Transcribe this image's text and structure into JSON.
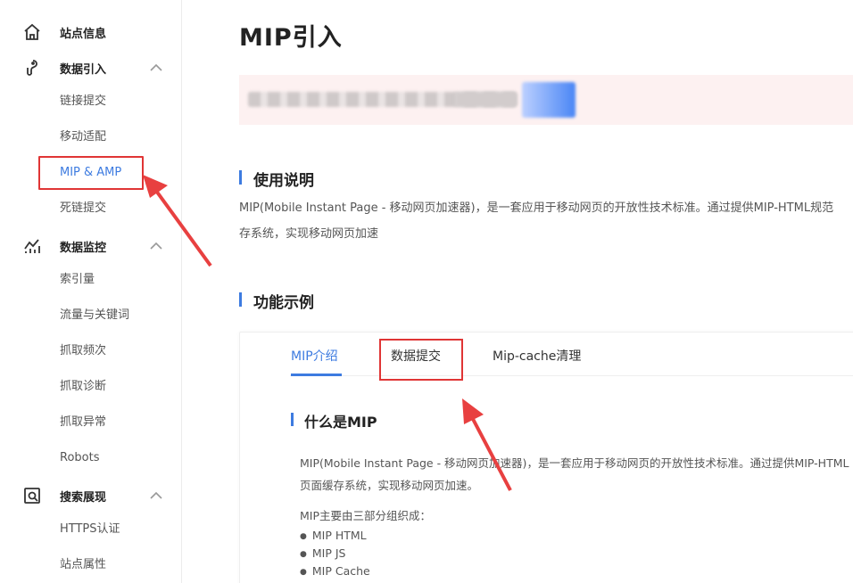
{
  "sidebar": {
    "groups": [
      {
        "label": "站点信息",
        "icon": "home-icon"
      },
      {
        "label": "数据引入",
        "icon": "data-import-icon",
        "items": [
          "链接提交",
          "移动适配",
          "MIP & AMP",
          "死链提交"
        ]
      },
      {
        "label": "数据监控",
        "icon": "chart-icon",
        "items": [
          "索引量",
          "流量与关键词",
          "抓取频次",
          "抓取诊断",
          "抓取异常",
          "Robots"
        ]
      },
      {
        "label": "搜索展现",
        "icon": "search-display-icon",
        "items": [
          "HTTPS认证",
          "站点属性"
        ]
      }
    ],
    "active_item": "MIP & AMP"
  },
  "main": {
    "title": "MIP引入",
    "usage_title": "使用说明",
    "usage_line1": "MIP(Mobile Instant Page - 移动网页加速器)，是一套应用于移动网页的开放性技术标准。通过提供MIP-HTML规范",
    "usage_line2": "存系统，实现移动网页加速",
    "feature_title": "功能示例",
    "tabs": [
      "MIP介绍",
      "数据提交",
      "Mip-cache清理"
    ],
    "what_title": "什么是MIP",
    "intro_line1": "MIP(Mobile Instant Page - 移动网页加速器)，是一套应用于移动网页的开放性技术标准。通过提供MIP-HTML",
    "intro_line2": "页面缓存系统，实现移动网页加速。",
    "parts_intro": "MIP主要由三部分组织成：",
    "parts": [
      "MIP HTML",
      "MIP JS",
      "MIP Cache"
    ]
  },
  "colors": {
    "accent": "#3d7be0",
    "annotation": "#e03535",
    "notice_bg": "#fdf1f1"
  }
}
